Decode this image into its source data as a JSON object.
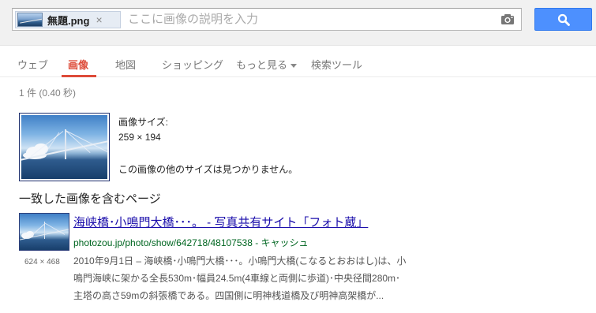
{
  "search": {
    "chip_filename": "無題.png",
    "chip_close": "×",
    "placeholder": "ここに画像の説明を入力",
    "value": ""
  },
  "icons": {
    "camera": "camera-icon",
    "search": "search-icon",
    "close": "close-icon",
    "dropdown": "caret-down-icon"
  },
  "colors": {
    "accent_red": "#dd4b39",
    "button_blue": "#4d90fe",
    "link_blue": "#1a0dab",
    "url_green": "#006621"
  },
  "tabs": [
    {
      "label": "ウェブ"
    },
    {
      "label": "画像",
      "active": true
    },
    {
      "label": "地図"
    },
    {
      "label": "ショッピング"
    },
    {
      "label": "もっと見る"
    },
    {
      "label": "検索ツール"
    }
  ],
  "result_stats": "1 件 (0.40 秒)",
  "image_info": {
    "size_label": "画像サイズ:",
    "size_value": "259 × 194",
    "no_other_sizes": "この画像の他のサイズは見つかりません。"
  },
  "section_heading": "一致した画像を含むページ",
  "result": {
    "thumb_dims": "624 × 468",
    "title": "海峡橋･小鳴門大橋･･･。 - 写真共有サイト「フォト蔵」",
    "url": "photozou.jp/photo/show/642718/48107538",
    "url_sep": " - ",
    "cache_label": "キャッシュ",
    "snippet_lines": [
      "2010年9月1日 – 海峡橋･小鳴門大橋･･･。小鳴門大橋(こなるとおおはし)は、小",
      "鳴門海峡に架かる全長530m･幅員24.5m(4車線と両側に歩道)･中央径間280m･",
      "主塔の高さ59mの斜張橋である。四国側に明神桟道橋及び明神高架橋が..."
    ]
  }
}
